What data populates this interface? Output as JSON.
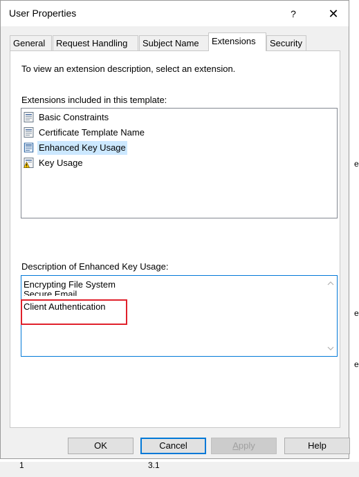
{
  "window": {
    "title": "User Properties",
    "help_glyph": "?",
    "close_glyph": "✕"
  },
  "tabs": [
    "General",
    "Request Handling",
    "Subject Name",
    "Extensions",
    "Security"
  ],
  "active_tab": "Extensions",
  "panel": {
    "instruction": "To view an extension description, select an extension.",
    "extensions_label": "Extensions included in this template:",
    "extensions": [
      {
        "label": "Basic Constraints",
        "icon": "extension-document-icon"
      },
      {
        "label": "Certificate Template Name",
        "icon": "extension-document-icon"
      },
      {
        "label": "Enhanced Key Usage",
        "icon": "extension-document-icon",
        "selected": true
      },
      {
        "label": "Key Usage",
        "icon": "warning-document-icon"
      }
    ],
    "description_label": "Description of Enhanced Key Usage:",
    "description_lines": [
      "Encrypting File System",
      "Secure Email",
      "Client Authentication"
    ],
    "highlight_color": "#e0202a"
  },
  "buttons": {
    "ok": "OK",
    "cancel": "Cancel",
    "apply_prefix": "",
    "apply_underlined": "A",
    "apply_rest": "pply",
    "help": "Help"
  },
  "background": {
    "col1": "1",
    "col2": "3.1",
    "edge_char": "e"
  }
}
